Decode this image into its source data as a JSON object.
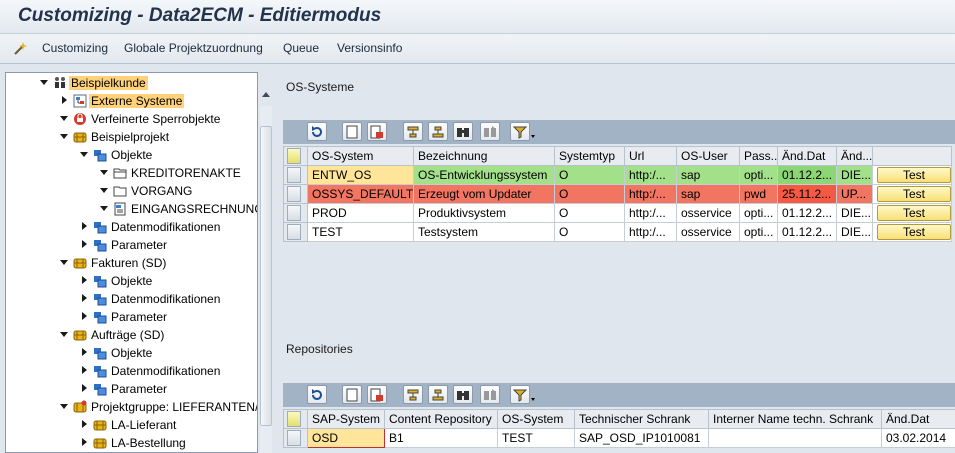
{
  "window": {
    "title": "Customizing - Data2ECM - Editiermodus"
  },
  "menu": {
    "icon": "wand-icon",
    "items": [
      "Customizing",
      "Globale Projektzuordnung",
      "Queue",
      "Versionsinfo"
    ]
  },
  "tree": {
    "items": [
      {
        "label": "Beispielkunde",
        "level": 0,
        "toggle": "down",
        "icon": "org-icon",
        "selected": true
      },
      {
        "label": "Externe Systeme",
        "level": 1,
        "toggle": "right",
        "icon": "systems-icon",
        "selected": true,
        "highlight": true
      },
      {
        "label": "Verfeinerte Sperrobjekte",
        "level": 1,
        "toggle": "down",
        "icon": "lock-object-icon"
      },
      {
        "label": "Beispielprojekt",
        "level": 1,
        "toggle": "down",
        "icon": "project-icon"
      },
      {
        "label": "Objekte",
        "level": 2,
        "toggle": "down",
        "icon": "objects-icon"
      },
      {
        "label": "KREDITORENAKTE",
        "level": 3,
        "toggle": "down",
        "icon": "folder-open-icon"
      },
      {
        "label": "VORGANG",
        "level": 3,
        "toggle": "down",
        "icon": "folder-icon"
      },
      {
        "label": "EINGANGSRECHNUNG",
        "level": 3,
        "toggle": "down",
        "icon": "document-icon"
      },
      {
        "label": "Datenmodifikationen",
        "level": 2,
        "toggle": "right",
        "icon": "objects-icon"
      },
      {
        "label": "Parameter",
        "level": 2,
        "toggle": "right",
        "icon": "objects-icon"
      },
      {
        "label": "Fakturen (SD)",
        "level": 1,
        "toggle": "down",
        "icon": "project-icon"
      },
      {
        "label": "Objekte",
        "level": 2,
        "toggle": "right",
        "icon": "objects-icon"
      },
      {
        "label": "Datenmodifikationen",
        "level": 2,
        "toggle": "right",
        "icon": "objects-icon"
      },
      {
        "label": "Parameter",
        "level": 2,
        "toggle": "right",
        "icon": "objects-icon"
      },
      {
        "label": "Aufträge (SD)",
        "level": 1,
        "toggle": "down",
        "icon": "project-icon"
      },
      {
        "label": "Objekte",
        "level": 2,
        "toggle": "right",
        "icon": "objects-icon"
      },
      {
        "label": "Datenmodifikationen",
        "level": 2,
        "toggle": "right",
        "icon": "objects-icon"
      },
      {
        "label": "Parameter",
        "level": 2,
        "toggle": "right",
        "icon": "objects-icon"
      },
      {
        "label": "Projektgruppe: LIEFERANTEN/",
        "level": 1,
        "toggle": "down",
        "icon": "project-group-icon"
      },
      {
        "label": "LA-Lieferant",
        "level": 2,
        "toggle": "right",
        "icon": "project-icon"
      },
      {
        "label": "LA-Bestellung",
        "level": 2,
        "toggle": "right",
        "icon": "project-icon"
      }
    ]
  },
  "os_systems": {
    "title": "OS-Systeme",
    "columns": [
      "OS-System",
      "Bezeichnung",
      "Systemtyp",
      "Url",
      "OS-User",
      "Pass...",
      "Änd.Dat",
      "Änd...",
      ""
    ],
    "button_label": "Test",
    "rows": [
      {
        "status": "green",
        "cells": [
          "ENTW_OS",
          "OS-Entwicklungssystem",
          "O",
          "http:/...",
          "sap",
          "opti...",
          "01.12.2...",
          "DIE..."
        ]
      },
      {
        "status": "red",
        "cells": [
          "OSSYS_DEFAULT",
          "Erzeugt vom Updater",
          "O",
          "http:/...",
          "sap",
          "pwd",
          "25.11.2...",
          "UP..."
        ]
      },
      {
        "status": "none",
        "cells": [
          "PROD",
          "Produktivsystem",
          "O",
          "http:/...",
          "osservice",
          "opti...",
          "01.12.2...",
          "DIE..."
        ]
      },
      {
        "status": "none",
        "cells": [
          "TEST",
          "Testsystem",
          "O",
          "http:/...",
          "osservice",
          "opti...",
          "01.12.2...",
          "DIE..."
        ]
      }
    ]
  },
  "repositories": {
    "title": "Repositories",
    "columns": [
      "SAP-System",
      "Content Repository",
      "OS-System",
      "Technischer Schrank",
      "Interner Name techn. Schrank",
      "Änd.Dat"
    ],
    "rows": [
      {
        "cells": [
          "OSD",
          "B1",
          "TEST",
          "SAP_OSD_IP1010081",
          "",
          "03.02.2014"
        ]
      }
    ]
  },
  "toolbar_icons": [
    "refresh-icon",
    "new-entry-icon",
    "delete-entry-icon",
    "sort-ascending-icon",
    "sort-descending-icon",
    "find-icon",
    "find-next-icon",
    "filter-icon"
  ]
}
